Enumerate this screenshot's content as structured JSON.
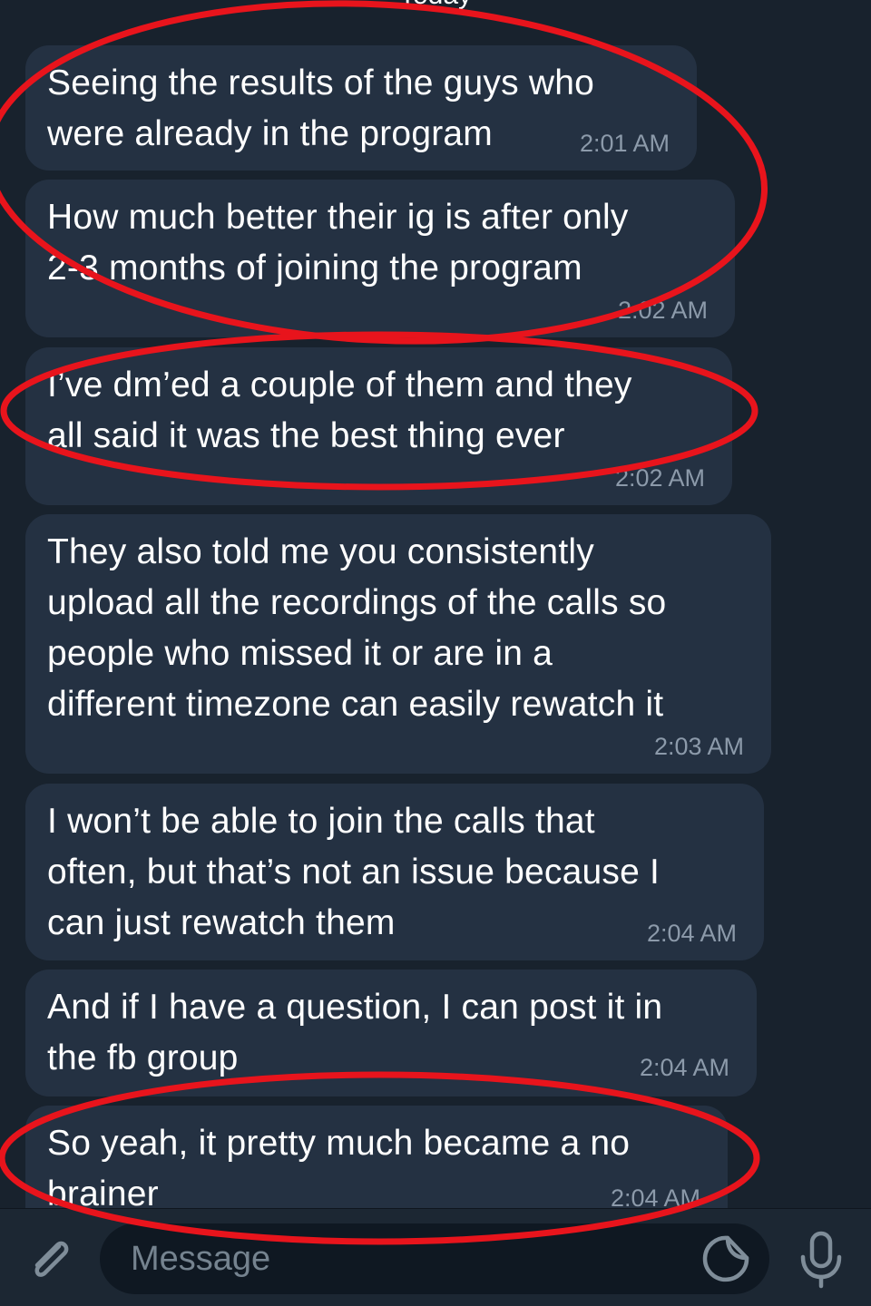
{
  "chat": {
    "day_label": "Today",
    "messages": [
      {
        "text": "Seeing the results of the guys who\nwere already in the program",
        "time": "2:01 AM"
      },
      {
        "text": "How much better their ig is after only\n2-3 months of joining the program",
        "time": "2:02 AM"
      },
      {
        "text": "I’ve dm’ed a couple of them and they\nall said it was the best thing ever",
        "time": "2:02 AM"
      },
      {
        "text": "They also told me you consistently\nupload all the recordings of the calls so\npeople who missed it or are in a\ndifferent timezone can easily rewatch it",
        "time": "2:03 AM"
      },
      {
        "text": "I won’t be able to join the calls that\noften, but that’s not an issue because I\ncan just rewatch them",
        "time": "2:04 AM"
      },
      {
        "text": "And if I have a question, I can post it in\nthe fb group",
        "time": "2:04 AM"
      },
      {
        "text": "So yeah, it pretty much became a no\nbrainer",
        "time": "2:04 AM"
      }
    ]
  },
  "composer": {
    "placeholder": "Message",
    "value": "",
    "icons": {
      "attach": "paperclip-icon",
      "sticker": "sticker-icon",
      "voice": "microphone-icon"
    }
  },
  "colors": {
    "background": "#18222d",
    "bubble": "#243142",
    "text": "#ffffff",
    "timestamp": "#8c9aaa",
    "annotation": "#e8141c",
    "icon": "#7f8d99"
  }
}
